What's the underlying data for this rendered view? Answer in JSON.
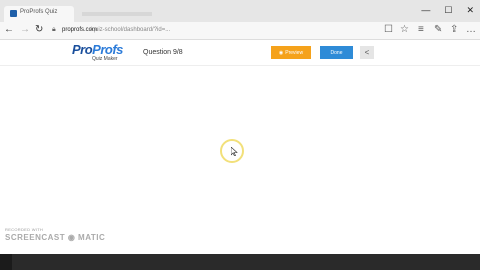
{
  "browser": {
    "tab_title": "ProProfs Quiz",
    "window_controls": {
      "minimize": "—",
      "maximize": "☐",
      "close": "✕"
    },
    "nav": {
      "back": "←",
      "forward": "→",
      "refresh": "↻"
    },
    "address": {
      "host": "proprofs.com",
      "path": "/quiz-school/dashboard/?id=... "
    },
    "toolbar_icons": {
      "reading": "☐",
      "favorite": "☆",
      "hub": "≡",
      "note": "✎",
      "share": "⇪",
      "more": "…"
    }
  },
  "app": {
    "logo": {
      "pro": "Pro",
      "profs": "Profs",
      "sub": "Quiz Maker"
    },
    "question_label": "Question 9/8",
    "preview_label": "Preview",
    "done_label": "Done",
    "collapse_label": "<"
  },
  "watermark": {
    "line1": "RECORDED WITH",
    "line2": "SCREENCAST ◉ MATIC"
  }
}
